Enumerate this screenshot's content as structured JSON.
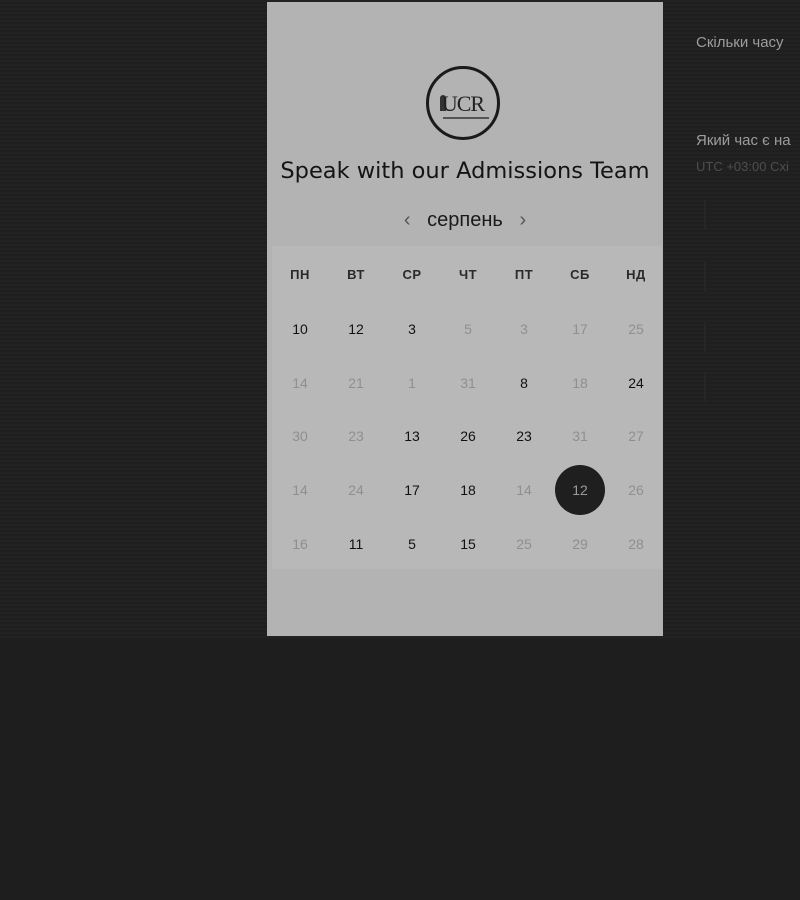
{
  "card": {
    "logo_text": "UCR",
    "title": "Speak with our Admissions Team"
  },
  "calendar": {
    "month": "серпень",
    "prev_icon": "chevron-left-icon",
    "next_icon": "chevron-right-icon",
    "weekdays": [
      "ПН",
      "ВТ",
      "СР",
      "ЧТ",
      "ПТ",
      "СБ",
      "НД"
    ],
    "weeks": [
      [
        {
          "d": "10",
          "muted": false
        },
        {
          "d": "12",
          "muted": false
        },
        {
          "d": "3",
          "muted": false
        },
        {
          "d": "5",
          "muted": true
        },
        {
          "d": "3",
          "muted": true
        },
        {
          "d": "17",
          "muted": true
        },
        {
          "d": "25",
          "muted": true
        }
      ],
      [
        {
          "d": "14",
          "muted": true
        },
        {
          "d": "21",
          "muted": true
        },
        {
          "d": "1",
          "muted": true
        },
        {
          "d": "31",
          "muted": true
        },
        {
          "d": "8",
          "muted": false
        },
        {
          "d": "18",
          "muted": true
        },
        {
          "d": "24",
          "muted": false
        }
      ],
      [
        {
          "d": "30",
          "muted": true
        },
        {
          "d": "23",
          "muted": true
        },
        {
          "d": "13",
          "muted": false
        },
        {
          "d": "26",
          "muted": false
        },
        {
          "d": "23",
          "muted": false
        },
        {
          "d": "31",
          "muted": true
        },
        {
          "d": "27",
          "muted": true
        }
      ],
      [
        {
          "d": "14",
          "muted": true
        },
        {
          "d": "24",
          "muted": true
        },
        {
          "d": "17",
          "muted": false
        },
        {
          "d": "18",
          "muted": false
        },
        {
          "d": "14",
          "muted": true
        },
        {
          "d": "12",
          "muted": false,
          "selected": true
        },
        {
          "d": "26",
          "muted": true
        }
      ],
      [
        {
          "d": "16",
          "muted": true
        },
        {
          "d": "11",
          "muted": false
        },
        {
          "d": "5",
          "muted": false
        },
        {
          "d": "15",
          "muted": false
        },
        {
          "d": "25",
          "muted": true
        },
        {
          "d": "29",
          "muted": true
        },
        {
          "d": "28",
          "muted": true
        }
      ]
    ]
  },
  "side": {
    "duration_question": "Скільки часу",
    "time_question": "Який час є на",
    "timezone": "UTC +03:00 Схі"
  }
}
